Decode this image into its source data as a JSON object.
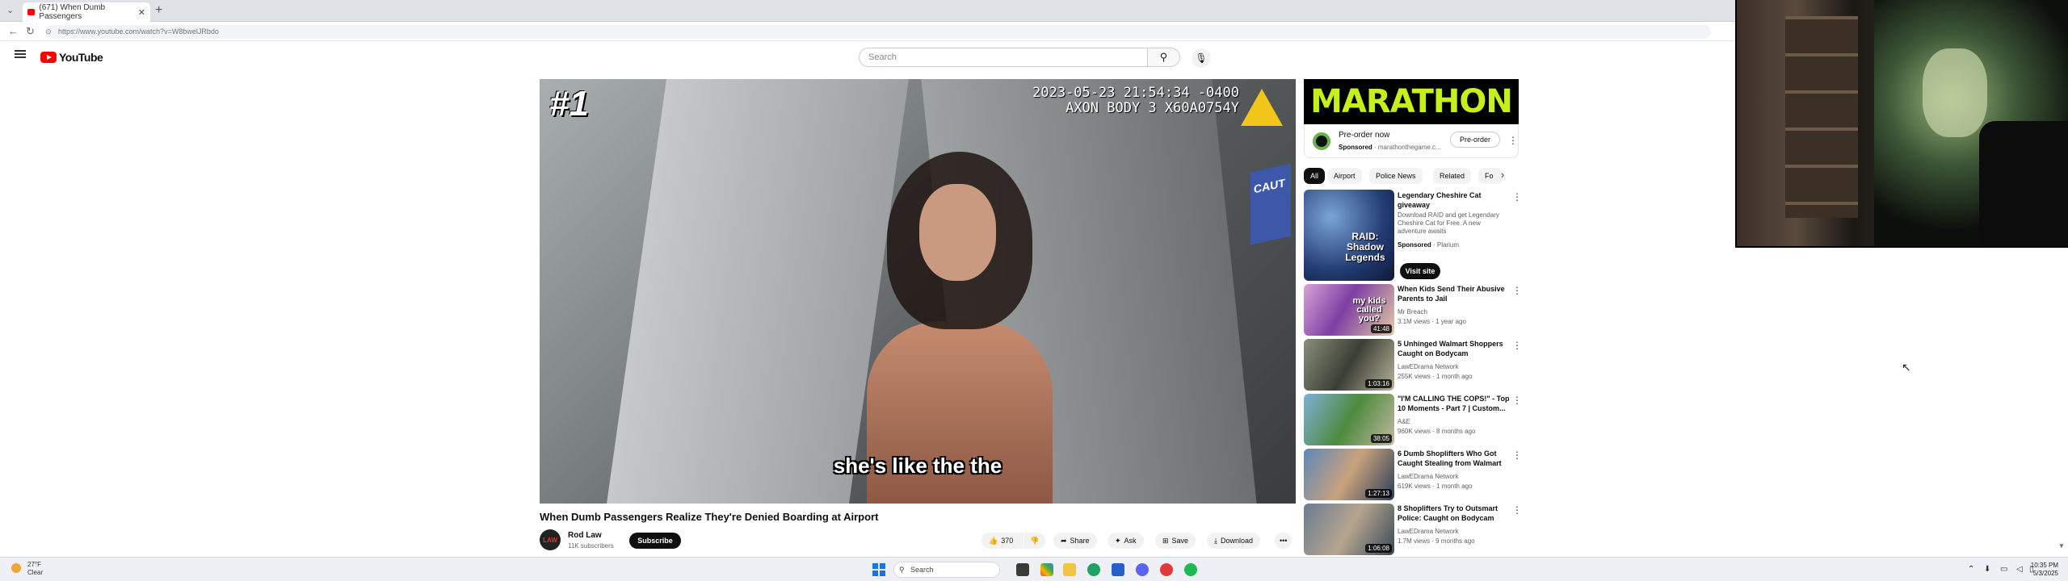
{
  "browser": {
    "tab_title": "(671) When Dumb Passengers",
    "url": "https://www.youtube.com/watch?v=W8bwelJRbdo"
  },
  "youtube": {
    "logo_text": "YouTube",
    "search_placeholder": "Search"
  },
  "video": {
    "rank_overlay": "#1",
    "timestamp_line1": "2023-05-23 21:54:34 -0400",
    "timestamp_line2": "AXON BODY 3 X60A0754Y",
    "caption": "she's like the the",
    "sign_text": "CAUT",
    "title": "When Dumb Passengers Realize They're Denied Boarding at Airport",
    "channel": "Rod Law",
    "channel_avatar_text": "LAW",
    "subscribers": "11K subscribers",
    "subscribe_label": "Subscribe",
    "likes": "370",
    "share_label": "Share",
    "ask_label": "Ask",
    "save_label": "Save",
    "download_label": "Download"
  },
  "sidebar": {
    "ad": {
      "banner": "MARATHON",
      "title": "Pre-order now",
      "sponsored": "Sponsored",
      "domain": "marathonthegame.c...",
      "cta": "Pre-order"
    },
    "chips": [
      "All",
      "Airport",
      "Police News",
      "Related",
      "Fo"
    ],
    "promo": {
      "title": "Legendary Cheshire Cat giveaway",
      "desc": "Download RAID and get Legendary Cheshire Cat for Free. A new adventure awaits",
      "sponsored": "Sponsored",
      "advertiser": "Plarium",
      "cta": "Visit site",
      "thumb_text": "RAID: Shadow Legends"
    },
    "recommendations": [
      {
        "title": "When Kids Send Their Abusive Parents to Jail",
        "channel": "Mr Breach",
        "meta": "3.1M views · 1 year ago",
        "duration": "41:48",
        "thumb_text": "my kids called you?"
      },
      {
        "title": "5 Unhinged Walmart Shoppers Caught on Bodycam",
        "channel": "LawEDrama Network",
        "meta": "255K views · 1 month ago",
        "duration": "1:03:16",
        "thumb_text": ""
      },
      {
        "title": "\"I'M CALLING THE COPS!\" - Top 10 Moments - Part 7 | Custom...",
        "channel": "A&E",
        "meta": "960K views · 8 months ago",
        "duration": "38:05",
        "thumb_text": ""
      },
      {
        "title": "6 Dumb Shoplifters Who Got Caught Stealing from Walmart",
        "channel": "LawEDrama Network",
        "meta": "619K views · 1 month ago",
        "duration": "1:27:13",
        "thumb_text": ""
      },
      {
        "title": "8 Shoplifters Try to Outsmart Police: Caught on Bodycam",
        "channel": "LawEDrama Network",
        "meta": "1.7M views · 9 months ago",
        "duration": "1:06:08",
        "thumb_text": ""
      }
    ]
  },
  "taskbar": {
    "temp": "27°F",
    "weather": "Clear",
    "search": "Search",
    "time": "10:35 PM",
    "date": "5/3/2025"
  },
  "colors": {
    "youtube_red": "#ff0000",
    "marathon_green": "#c6f01a",
    "axon_yellow": "#f2c51b"
  }
}
